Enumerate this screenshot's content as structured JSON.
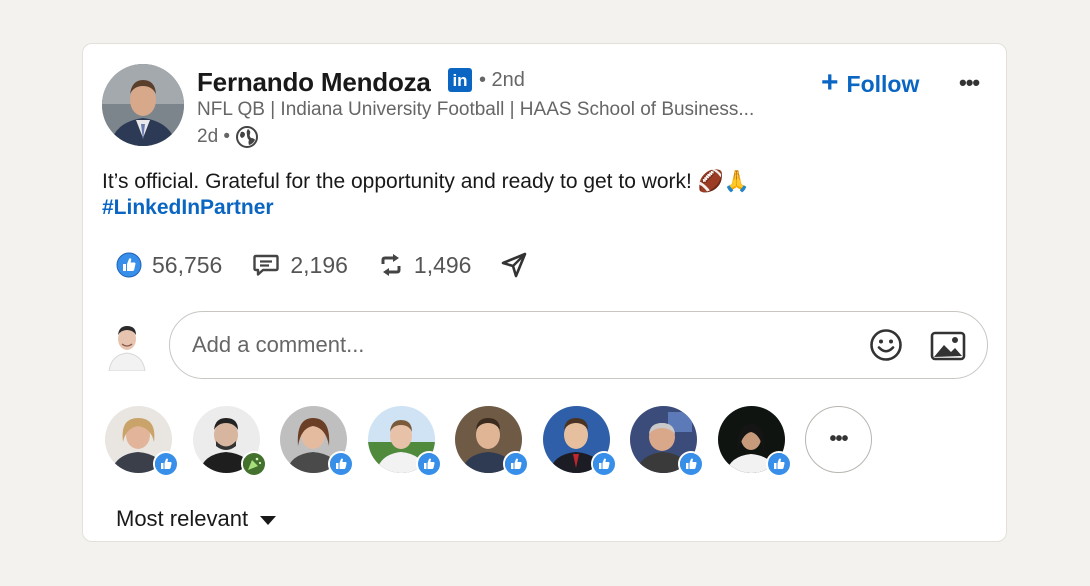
{
  "post": {
    "author": {
      "name": "Fernando Mendoza",
      "badge": "in",
      "degree": "• 2nd",
      "headline": "NFL QB | Indiana University Football | HAAS School of Business...",
      "time": "2d •"
    },
    "follow_label": "Follow",
    "more_label": "•••",
    "text": "It’s official. Grateful for the opportunity and ready to get to work! 🏈🙏",
    "hashtag": "#LinkedInPartner",
    "stats": {
      "likes": "56,756",
      "comments": "2,196",
      "reposts": "1,496"
    }
  },
  "comment": {
    "placeholder": "Add a comment..."
  },
  "reactors": {
    "more_label": "•••"
  },
  "sort": {
    "label": "Most relevant"
  },
  "colors": {
    "brand": "#0a66c2",
    "background": "#f4f2ee",
    "muted_text": "#666666"
  },
  "icons": [
    "linkedin-badge-icon",
    "globe-icon",
    "plus-icon",
    "more-icon",
    "like-icon",
    "comment-icon",
    "repost-icon",
    "send-icon",
    "emoji-icon",
    "image-icon",
    "caret-down-icon",
    "celebrate-icon"
  ]
}
